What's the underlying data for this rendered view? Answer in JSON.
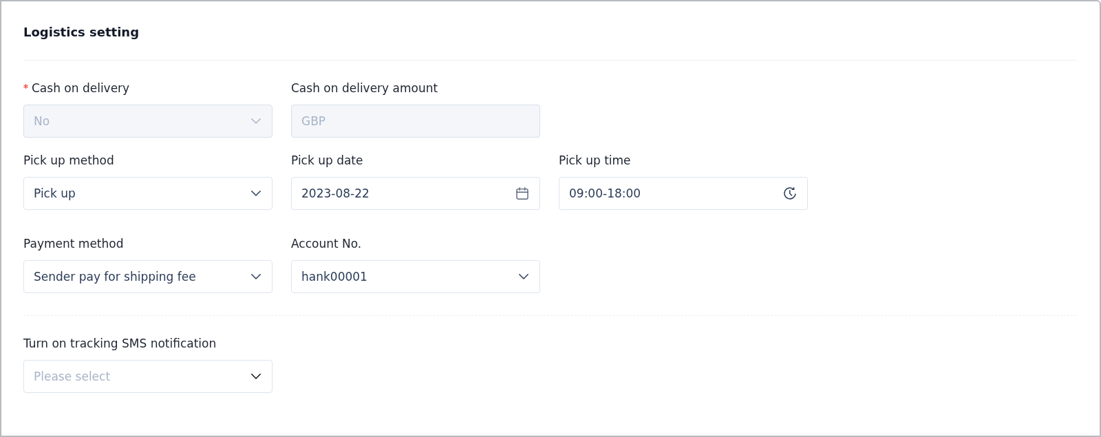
{
  "title": "Logistics setting",
  "sections": [
    {
      "rows": [
        [
          {
            "label": "Cash on delivery",
            "required": true,
            "kind": "select",
            "value": "No",
            "disabled": true
          },
          {
            "label": "Cash on delivery amount",
            "required": false,
            "kind": "text",
            "value": "GBP",
            "disabled": true
          }
        ],
        [
          {
            "label": "Pick up method",
            "required": false,
            "kind": "select",
            "value": "Pick up",
            "disabled": false
          },
          {
            "label": "Pick up date",
            "required": false,
            "kind": "date",
            "value": "2023-08-22",
            "disabled": false
          },
          {
            "label": "Pick up time",
            "required": false,
            "kind": "time",
            "value": "09:00-18:00",
            "disabled": false
          }
        ],
        [
          {
            "label": "Payment method",
            "required": false,
            "kind": "select",
            "value": "Sender pay for shipping fee",
            "disabled": false
          },
          {
            "label": "Account No.",
            "required": false,
            "kind": "select",
            "value": "hank00001",
            "disabled": false
          }
        ]
      ]
    },
    {
      "rows": [
        [
          {
            "label": "Turn on tracking SMS notification",
            "required": false,
            "kind": "select",
            "placeholder": "Please select",
            "disabled": false
          }
        ]
      ]
    }
  ]
}
